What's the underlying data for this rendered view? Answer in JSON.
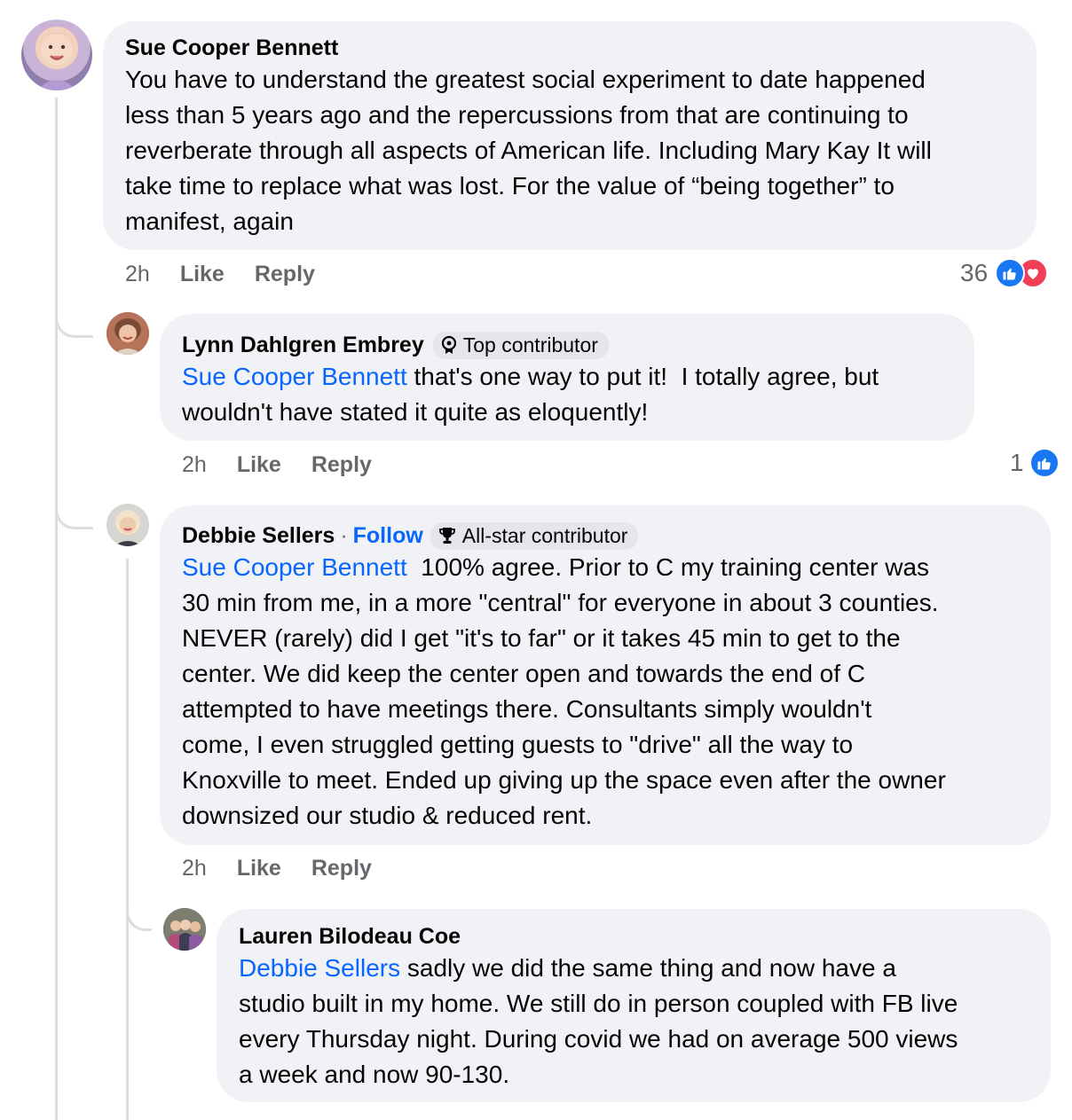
{
  "comments": [
    {
      "author": "Sue Cooper Bennett",
      "text_lines": [
        "You have to understand the greatest social experiment  to date happened",
        "less than 5 years ago and the repercussions from that are continuing to",
        "reverberate through all aspects of American life. Including Mary Kay It will",
        "take time to replace what was lost. For the value of “being together” to",
        "manifest, again"
      ],
      "time": "2h",
      "like_label": "Like",
      "reply_label": "Reply",
      "reaction_count": "36",
      "reaction_icons": [
        "thumbs-up-icon",
        "heart-icon"
      ]
    },
    {
      "author": "Lynn Dahlgren Embrey",
      "badge": "Top contributor",
      "badge_icon": "badge-icon",
      "mention": "Sue Cooper Bennett",
      "text_first_rest": " that's one way to put it!  I totally agree, but",
      "text_lines": [
        "wouldn't have stated it quite as eloquently!"
      ],
      "time": "2h",
      "like_label": "Like",
      "reply_label": "Reply",
      "reaction_count": "1",
      "reaction_icons": [
        "thumbs-up-icon"
      ]
    },
    {
      "author": "Debbie Sellers",
      "separator": "·",
      "follow_label": "Follow",
      "badge": "All-star contributor",
      "badge_icon": "trophy-icon",
      "mention": "Sue Cooper Bennett",
      "text_first_rest": "  100% agree. Prior to C my training center was",
      "text_lines": [
        "30 min from me, in a more \"central\" for everyone in about 3 counties.",
        "NEVER (rarely) did I get \"it's to far\" or it takes 45 min to get to the",
        "center.  We did keep the center open and towards the end of C",
        "attempted to have meetings there.  Consultants simply wouldn't",
        "come, I even struggled getting guests to \"drive\" all the way to",
        "Knoxville to meet.  Ended up giving up the space even after the owner",
        "downsized our studio & reduced rent."
      ],
      "time": "2h",
      "like_label": "Like",
      "reply_label": "Reply"
    },
    {
      "author": "Lauren Bilodeau Coe",
      "mention": "Debbie Sellers",
      "text_first_rest": " sadly we did the same thing and now have a",
      "text_lines": [
        "studio built in my home. We still do in person coupled with FB live",
        "every Thursday night. During covid we had on average 500 views",
        "a week and now 90-130."
      ]
    }
  ],
  "colors": {
    "bubble": "#f0f2f5",
    "mention": "#0866ff",
    "meta": "#65676b",
    "like": "#1877f2",
    "love": "#f33e58",
    "thread_line": "#dadde1"
  }
}
